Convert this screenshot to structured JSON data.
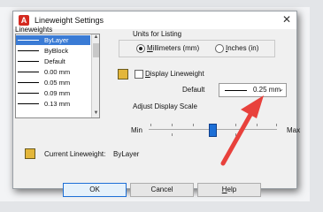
{
  "window": {
    "title": "Lineweight Settings",
    "close_glyph": "✕"
  },
  "lineweights": {
    "header": "Lineweights",
    "items": [
      {
        "label": "ByLayer",
        "selected": true
      },
      {
        "label": "ByBlock",
        "selected": false
      },
      {
        "label": "Default",
        "selected": false
      },
      {
        "label": "0.00 mm",
        "selected": false
      },
      {
        "label": "0.05 mm",
        "selected": false
      },
      {
        "label": "0.09 mm",
        "selected": false
      },
      {
        "label": "0.13 mm",
        "selected": false
      }
    ]
  },
  "units": {
    "header": "Units for Listing",
    "millimeters": {
      "prefix": "",
      "accel": "M",
      "rest": "illimeters (mm)",
      "selected": true
    },
    "inches": {
      "prefix": "",
      "accel": "I",
      "rest": "nches (in)",
      "selected": false
    }
  },
  "display_lineweight": {
    "accel": "D",
    "rest": "isplay Lineweight",
    "checked": false
  },
  "default": {
    "label": "Default",
    "value": "0.25 mm"
  },
  "scale": {
    "header": "Adjust Display Scale",
    "min_label": "Min",
    "max_label": "Max",
    "level": 0.45
  },
  "current": {
    "label": "Current Lineweight:",
    "value": "ByLayer"
  },
  "buttons": {
    "ok": "OK",
    "cancel": "Cancel",
    "help_accel": "H",
    "help_rest": "elp"
  },
  "colors": {
    "accent": "#1d6fd6",
    "selection": "#3a7bd5",
    "arrow": "#e8413c"
  }
}
